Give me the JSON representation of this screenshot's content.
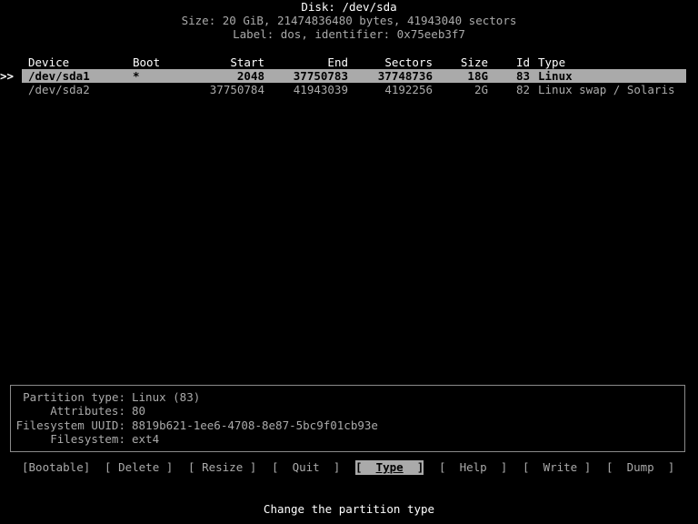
{
  "header": {
    "disk_title": "Disk: /dev/sda",
    "size_line": "Size: 20 GiB, 21474836480 bytes, 41943040 sectors",
    "label_line": "Label: dos, identifier: 0x75eeb3f7"
  },
  "table": {
    "columns": {
      "device": "Device",
      "boot": "Boot",
      "start": "Start",
      "end": "End",
      "sectors": "Sectors",
      "size": "Size",
      "id": "Id",
      "type": "Type"
    },
    "pointer": ">>",
    "rows": [
      {
        "device": "/dev/sda1",
        "boot": "*",
        "start": "2048",
        "end": "37750783",
        "sectors": "37748736",
        "size": "18G",
        "id": "83",
        "type": "Linux"
      },
      {
        "device": "/dev/sda2",
        "boot": "",
        "start": "37750784",
        "end": "41943039",
        "sectors": "4192256",
        "size": "2G",
        "id": "82",
        "type": "Linux swap / Solaris"
      }
    ]
  },
  "info": {
    "partition_type_label": "Partition type:",
    "partition_type_value": "Linux (83)",
    "attributes_label": "Attributes:",
    "attributes_value": "80",
    "uuid_label": "Filesystem UUID:",
    "uuid_value": "8819b621-1ee6-4708-8e87-5bc9f01cb93e",
    "filesystem_label": "Filesystem:",
    "filesystem_value": "ext4"
  },
  "menu": {
    "bootable": "Bootable",
    "delete": "Delete",
    "resize": "Resize",
    "quit": "Quit",
    "type": "Type",
    "help": "Help",
    "write": "Write",
    "dump": "Dump",
    "selected": "Type"
  },
  "status": {
    "hint": "Change the partition type"
  }
}
